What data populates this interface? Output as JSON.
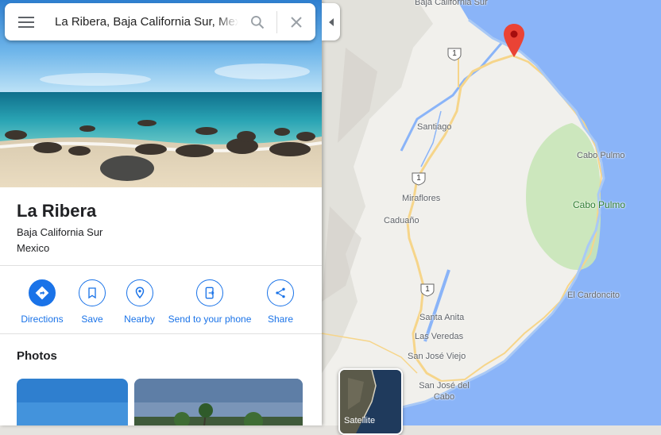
{
  "search": {
    "query": "La Ribera, Baja California Sur, Mexico"
  },
  "place": {
    "name": "La Ribera",
    "region": "Baja California Sur",
    "country": "Mexico"
  },
  "actions": [
    {
      "label": "Directions",
      "icon": "directions-icon"
    },
    {
      "label": "Save",
      "icon": "bookmark-icon"
    },
    {
      "label": "Nearby",
      "icon": "nearby-icon"
    },
    {
      "label": "Send to your phone",
      "icon": "send-to-phone-icon"
    },
    {
      "label": "Share",
      "icon": "share-icon"
    }
  ],
  "photos": {
    "title": "Photos"
  },
  "map": {
    "labels": {
      "baja_california_sur": "Baja California Sur",
      "santiago": "Santiago",
      "miraflores": "Miraflores",
      "caduano": "Caduaño",
      "santa_anita": "Santa Anita",
      "las_veredas": "Las Veredas",
      "san_jose_viejo": "San José Viejo",
      "san_jose_del_cabo": "San José del Cabo",
      "cabo_pulmo_town": "Cabo Pulmo",
      "cabo_pulmo_park": "Cabo Pulmo",
      "el_cardoncito": "El Cardoncito"
    },
    "highway_number": "1",
    "satellite_label": "Satellite"
  },
  "colors": {
    "accent": "#1a73e8",
    "water": "#8ab4f8",
    "land": "#f1f0ec",
    "park": "#c8e6b8",
    "road": "#f6d58a",
    "pin": "#ea4335"
  }
}
